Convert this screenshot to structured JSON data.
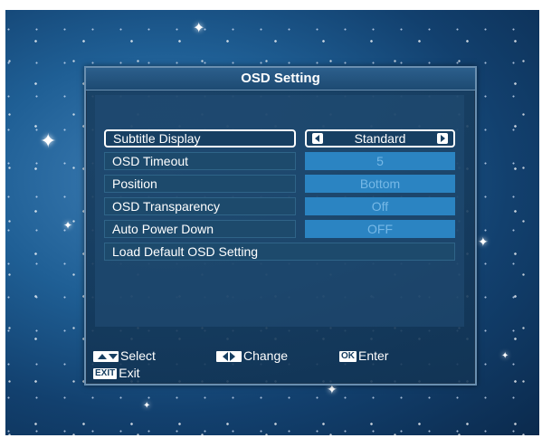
{
  "dialog": {
    "title": "OSD Setting"
  },
  "menu": {
    "items": [
      {
        "label": "Subtitle Display",
        "value": "Standard",
        "selected": true
      },
      {
        "label": "OSD Timeout",
        "value": "5"
      },
      {
        "label": "Position",
        "value": "Bottom"
      },
      {
        "label": "OSD Transparency",
        "value": "Off"
      },
      {
        "label": "Auto Power Down",
        "value": "OFF"
      }
    ],
    "action": {
      "label": "Load Default OSD Setting"
    }
  },
  "footer": {
    "select": {
      "key_icon": "up-down-arrow-key-icon",
      "label": "Select"
    },
    "change": {
      "key_icon": "left-right-arrow-key-icon",
      "label": "Change"
    },
    "enter": {
      "key": "OK",
      "label": "Enter"
    },
    "exit": {
      "key": "EXIT",
      "label": "Exit"
    }
  },
  "colors": {
    "panel_border": "#6a8fb0",
    "value_background": "#2b84c2",
    "selected_border": "#ffffff"
  }
}
